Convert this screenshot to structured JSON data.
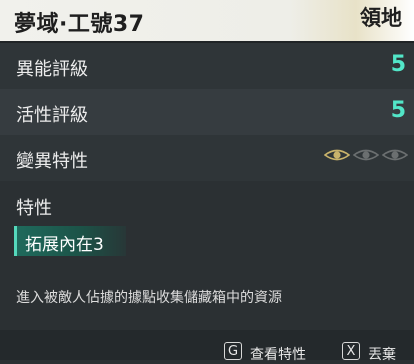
{
  "header": {
    "title": "夢域·工號37",
    "territory_label": "領地"
  },
  "stats": [
    {
      "label": "異能評級",
      "value": "5"
    },
    {
      "label": "活性評級",
      "value": "5"
    }
  ],
  "mutation": {
    "label": "變異特性",
    "level": 1,
    "max": 3,
    "active_color": "#c9b36b",
    "inactive_color": "#6b6f70"
  },
  "traits": {
    "label": "特性",
    "items": [
      "拓展內在3"
    ]
  },
  "description": "進入被敵人佔據的據點收集儲藏箱中的資源",
  "actions": [
    {
      "key": "G",
      "label": "查看特性"
    },
    {
      "key": "X",
      "label": "丟棄"
    }
  ],
  "colors": {
    "accent": "#52e6c8"
  }
}
